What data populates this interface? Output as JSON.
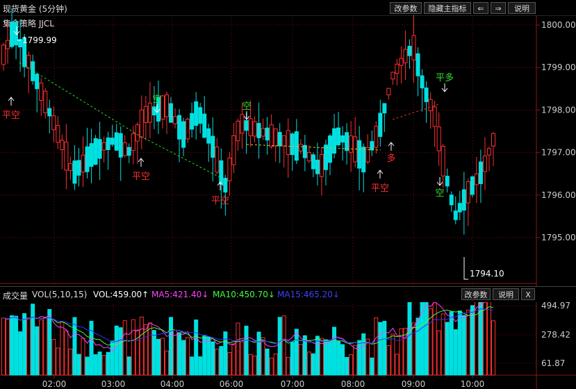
{
  "window": {
    "title": "现货黄金 (5分钟)",
    "buttons": {
      "params": "改参数",
      "hide": "隐藏主指标",
      "left": "⇐",
      "right": "⇒",
      "help": "说明"
    }
  },
  "indicator_name": "集金策略 JJCL",
  "colors": {
    "up": "#ff3030",
    "down": "#00e0e0",
    "grid": "#7a1010",
    "bg": "#000000"
  },
  "price_axis": {
    "ticks": [
      "1800.00",
      "1799.00",
      "1798.00",
      "1797.00",
      "1796.00",
      "1795.00"
    ]
  },
  "time_axis": {
    "ticks": [
      "02:00",
      "03:00",
      "04:00",
      "06:00",
      "07:00",
      "08:00",
      "09:00",
      "10:00"
    ]
  },
  "annotations": {
    "high": "1799.99",
    "low": "1794.10",
    "signals": [
      "平空",
      "空",
      "平空",
      "空",
      "平空",
      "多",
      "平空",
      "平多",
      "空"
    ]
  },
  "volume_panel": {
    "title": "成交量",
    "params": "VOL(5,10,15)",
    "vol": "VOL:459.00↑",
    "ma5": "MA5:421.40↓",
    "ma10": "MA10:450.70↓",
    "ma15": "MA15:465.20↓",
    "buttons": {
      "params": "改参数",
      "help": "说明",
      "close": "X"
    },
    "ticks": [
      "494.97",
      "278.42",
      "61.87"
    ],
    "colors": {
      "ma5": "#ff40ff",
      "ma10": "#40ff40",
      "ma15": "#3030ff",
      "vol_label": "#ffffff"
    }
  }
}
